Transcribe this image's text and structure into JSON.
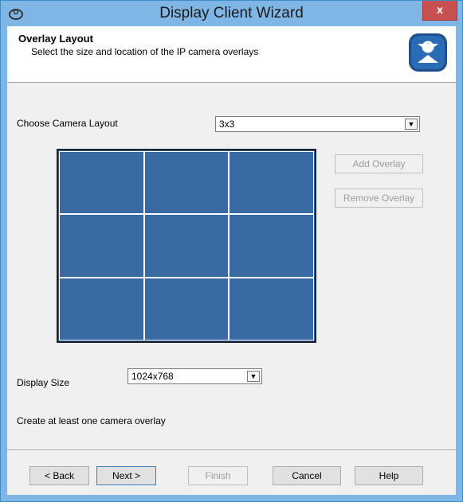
{
  "window": {
    "title": "Display Client Wizard",
    "close_label": "x"
  },
  "header": {
    "title": "Overlay Layout",
    "subtitle": "Select the size and location of the IP camera overlays",
    "logo_icon": "thinmanager-logo-icon"
  },
  "camera_layout": {
    "label": "Choose Camera Layout",
    "value": "3x3",
    "rows": 3,
    "cols": 3
  },
  "overlay_buttons": {
    "add_label": "Add Overlay",
    "remove_label": "Remove Overlay"
  },
  "display_size": {
    "label": "Display Size",
    "value": "1024x768"
  },
  "status_text": "Create at least one camera overlay",
  "footer": {
    "back": "< Back",
    "next": "Next >",
    "finish": "Finish",
    "cancel": "Cancel",
    "help": "Help"
  },
  "colors": {
    "grid_fill": "#3a6aa3",
    "title_bar": "#7fb6e6",
    "close_button": "#c75050"
  }
}
